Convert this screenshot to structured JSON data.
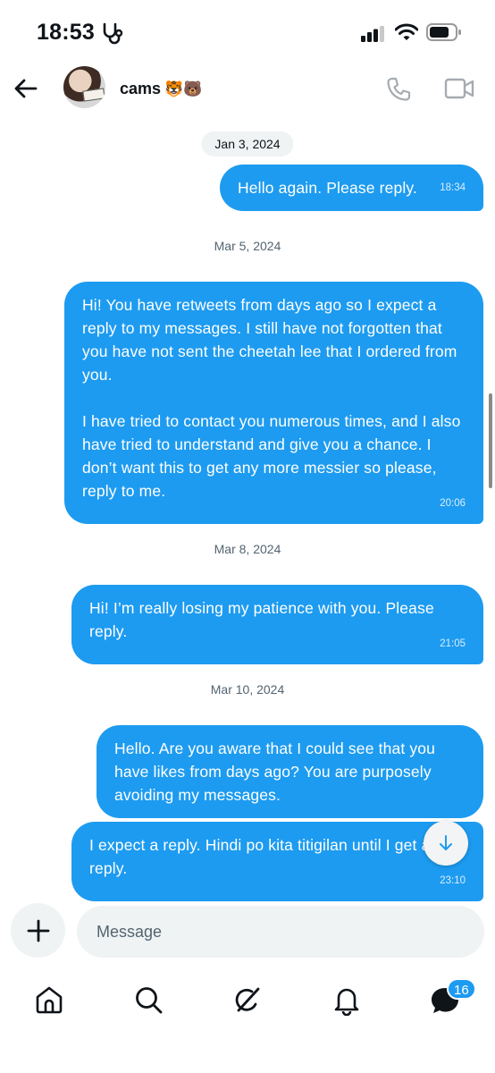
{
  "status_bar": {
    "time": "18:53"
  },
  "header": {
    "contact_name": "cams",
    "contact_emoji": "🐯🐻"
  },
  "conversation": {
    "dates": [
      "Jan 3, 2024",
      "Mar 5, 2024",
      "Mar 8, 2024",
      "Mar 10, 2024"
    ],
    "messages": [
      {
        "text": "Hello again. Please reply.",
        "time": "18:34"
      },
      {
        "text": "Hi! You have retweets from days ago so I expect a reply to my messages. I still have not forgotten that you have not sent the cheetah lee that I ordered from you.\n\nI have tried to contact you numerous times, and I also have tried to understand and give you a chance. I don’t want this to get any more messier so please, reply to me.",
        "time": "20:06"
      },
      {
        "text": "Hi! I’m really losing my patience with you. Please reply.",
        "time": "21:05"
      },
      {
        "text": "Hello. Are you aware that I could see that you have likes from days ago? You are purposely avoiding my messages.",
        "time": ""
      },
      {
        "text": "I expect a reply. Hindi po kita titigilan until I get a reply.",
        "time": "23:10"
      }
    ]
  },
  "composer": {
    "placeholder": "Message"
  },
  "nav": {
    "messages_badge": "16"
  },
  "colors": {
    "accent": "#1d9bf0",
    "chip_bg": "#eff3f4"
  }
}
